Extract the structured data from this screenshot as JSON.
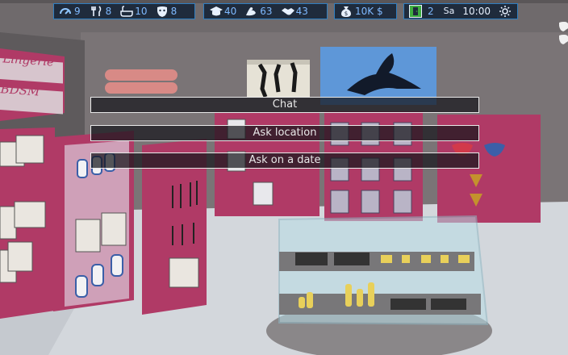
{
  "hud": {
    "group1": [
      {
        "icon": "energy-gauge-icon",
        "value": "9"
      },
      {
        "icon": "fork-knife-icon",
        "value": "8"
      },
      {
        "icon": "bathtub-icon",
        "value": "10"
      },
      {
        "icon": "theater-mask-icon",
        "value": "8"
      }
    ],
    "group2": [
      {
        "icon": "graduation-cap-icon",
        "value": "40"
      },
      {
        "icon": "flexed-arm-icon",
        "value": "63"
      },
      {
        "icon": "handshake-icon",
        "value": "43"
      }
    ],
    "money": {
      "icon": "money-bag-icon",
      "value": "10K $"
    },
    "time": {
      "icon": "door-exit-icon",
      "day_number": "2",
      "weekday": "Sa",
      "clock": "10:00",
      "weather_icon": "sun-icon"
    }
  },
  "sign": {
    "line1": "Lingerie",
    "line2": "BDSM"
  },
  "options": [
    {
      "label": "Chat"
    },
    {
      "label": "Ask location"
    },
    {
      "label": "Ask on a date"
    }
  ],
  "colors": {
    "hud_border": "#2f7fc1",
    "hud_bg": "#1f2b3c",
    "hud_text": "#8fc6ff",
    "shelf": "#b03a66"
  }
}
